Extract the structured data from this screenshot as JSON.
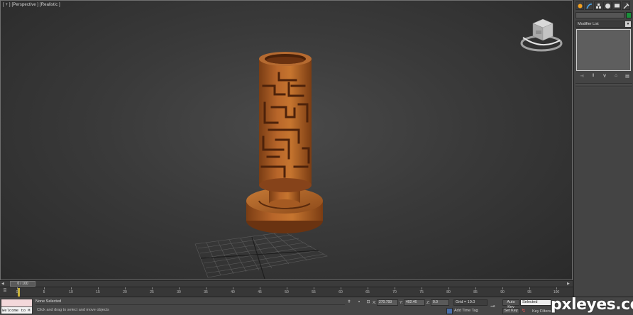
{
  "viewport": {
    "label": "[ + ] [Perspective ] [Realistic ]"
  },
  "command_panel": {
    "tabs": [
      "create-icon",
      "modify-icon",
      "hierarchy-icon",
      "motion-icon",
      "display-icon",
      "utilities-icon"
    ],
    "modifier_list": "Modifier List",
    "swatch_color": "#1a8f3a"
  },
  "timeline": {
    "slider_value": "0 / 100",
    "ticks": [
      "0",
      "5",
      "10",
      "15",
      "20",
      "25",
      "30",
      "35",
      "40",
      "45",
      "50",
      "55",
      "60",
      "65",
      "70",
      "75",
      "80",
      "85",
      "90",
      "95",
      "100"
    ]
  },
  "status": {
    "maxscript_text": "Welcome to M",
    "selection": "None Selected",
    "prompt": "Click and drag to select and move objects",
    "x_label": "X:",
    "x_value": "270.793",
    "y_label": "Y:",
    "y_value": "402.46",
    "z_label": "Z:",
    "z_value": "0.0",
    "grid": "Grid = 10.0",
    "add_time_tag": "Add Time Tag",
    "auto_key": "Auto Key",
    "key_mode": "Selected",
    "set_key": "Set Key",
    "key_filters": "Key Filters..."
  },
  "watermark": "pxleyes.com"
}
